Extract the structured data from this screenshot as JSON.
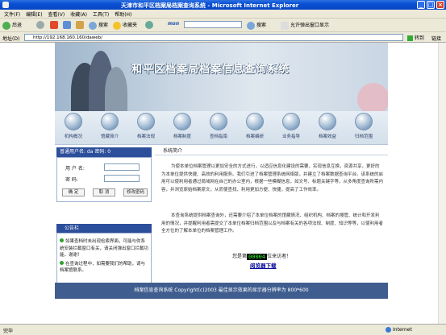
{
  "window": {
    "title": "天津市和平区档案局档案查询系统 - Microsoft Internet Explorer",
    "btn_min": "_",
    "btn_max": "□",
    "btn_close": "×"
  },
  "menu": [
    "文件(F)",
    "编辑(E)",
    "查看(V)",
    "收藏(A)",
    "工具(T)",
    "帮助(H)"
  ],
  "toolbar": {
    "back": "后退",
    "search": "搜索",
    "favorites": "收藏夹",
    "msn": "msn",
    "search2": "搜索",
    "popup": "允许弹出窗口显示"
  },
  "address": {
    "label": "地址(D)",
    "url": "http://192.168.160.160/daweb/",
    "go": "转到",
    "links": "链接"
  },
  "banner": {
    "title": "和平区档案局档案信息查询系统"
  },
  "nav": [
    "机构概况",
    "馆藏简介",
    "档案法规",
    "档案制度",
    "查档指南",
    "档案编研",
    "业务指导",
    "档案效益",
    "归档范围"
  ],
  "login": {
    "header": "普通用户名: da  密码: 0",
    "username_label": "用 户 名:",
    "password_label": "密   码:",
    "confirm": "确  定",
    "cancel": "取  消",
    "change_pwd": "修改密码"
  },
  "notice": {
    "header": "公告栏",
    "items": [
      "如果查档时未出现检索界面，可能与你系统安装拦截窗口有关，请关闭弹出窗口拦截功能。谢谢！",
      "在查询过程中，如需要我们的帮助，请与档案馆联系。"
    ]
  },
  "intro": {
    "header": "系统简介",
    "para1": "为使本单位档案管理以更加安全的方式进行，以适应信息化建设的需要，实现信息互换，资源共享，更好的为本单位提供快捷、高效的利用服务。我们引进了档案管理系统网络版，并建立了档案数据查询平台。该系统的启用可以使利用者通过局域网在自己的办公室内，根据一些模糊信息，如文号、标题关键字等，从多角度查询所需内容，并浏览原始档案原文，从而使查找、利用更加方便、快捷，提高了工作效率。",
    "para2": "本查询系统提供档案查询外，还需要介绍了本单位档案的馆藏情况、组织机构、档案的搜管、统计和开发利用的情况，并提醒利用者需提交了本单位档案归档范围以及与档案有关的各项法规、制度、知识等等，以使利用者全方位的了解本单位的档案管理工作。"
  },
  "visit": {
    "prefix": "您是第",
    "count": "00004",
    "suffix": "位来访者！"
  },
  "download": "阅览器下载",
  "footer": "档案信息查询系统  Copyright(c)2003 最佳显示效果的显示器分辨率为 800*600",
  "status": {
    "left": "完毕",
    "zone": "Internet"
  }
}
